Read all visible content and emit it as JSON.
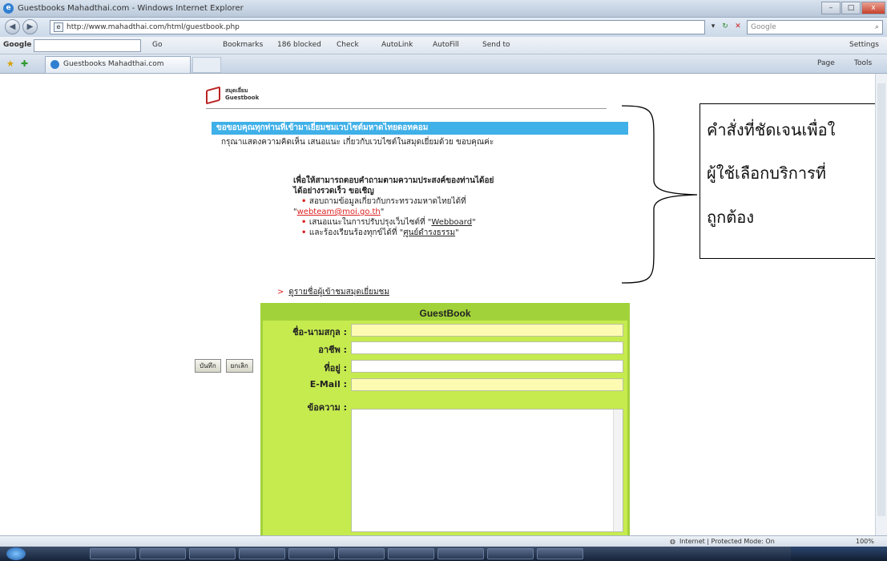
{
  "window": {
    "title": "Guestbooks Mahadthai.com - Windows Internet Explorer",
    "minimize": "–",
    "maximize": "□",
    "close": "x"
  },
  "address_bar": {
    "url": "http://www.mahadthai.com/html/guestbook.php",
    "search_placeholder": "Google"
  },
  "google_toolbar": {
    "logo": "Google",
    "go_label": "Go",
    "bookmarks": "Bookmarks",
    "blocked": "186 blocked",
    "check": "Check",
    "autolink": "AutoLink",
    "autofill": "AutoFill",
    "send_to": "Send to",
    "settings": "Settings"
  },
  "tab": {
    "label": "Guestbooks Mahadthai.com",
    "page_menu": "Page",
    "tools_menu": "Tools"
  },
  "page": {
    "logo_line1": "สมุดเยี่ยม",
    "logo_line2": "Guestbook",
    "welcome": "ขอขอบคุณทุกท่านที่เข้ามาเยี่ยมชมเวบไซต์มหาดไทยดอทคอม",
    "intro": "กรุณาแสดงความคิดเห็น เสนอแนะ เกี่ยวกับเวบไซต์ในสมุดเยี่ยมด้วย ขอบคุณค่ะ",
    "info_head1": "เพื่อให้สามารถตอบคำถามตามความประสงค์ของท่านได้อย่",
    "info_head2": "ได้อย่างรวดเร็ว ขอเชิญ",
    "item1_text": "สอบถามข้อมูลเกี่ยวกับกระทรวงมหาดไทยได้ที่",
    "item1_email": "webteam@moi.go.th",
    "item2_text": "เสนอแนะในการปรับปรุงเว็บไซต์ที่ ",
    "item2_link": "Webboard",
    "item3_text": "และร้องเรียนร้องทุกข์ได้ที่ ",
    "item3_link": "ศูนย์ดำรงธรรม",
    "view_link": "ดูรายชื่อผู้เข้าชมสมุดเยี่ยมชม"
  },
  "guestbook": {
    "title": "GuestBook",
    "name_label": "ชื่อ-นามสกุล :",
    "occupation_label": "อาชีพ :",
    "address_label": "ที่อยู่ :",
    "email_label": "E-Mail :",
    "message_label": "ข้อความ :",
    "submit_label": "บันทึก",
    "cancel_label": "ยกเลิก"
  },
  "annotation": {
    "line1": "คำสั่งที่ชัดเจนเพื่อใ",
    "line2": "ผู้ใช้เลือกบริการที่",
    "line3": "ถูกต้อง"
  },
  "status": {
    "zone": "Internet | Protected Mode: On",
    "zoom": "100%"
  }
}
